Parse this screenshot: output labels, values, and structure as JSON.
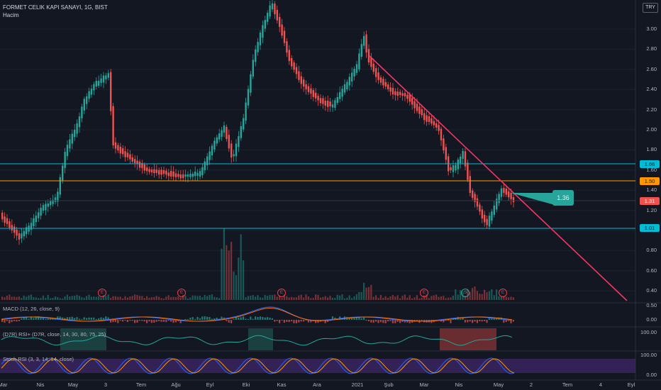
{
  "header": {
    "symbol_line": "FORMET CELIK KAPI SANAYI, 1G, BIST",
    "volume_label": "Hacim",
    "currency_button": "TRY"
  },
  "price_axis": [
    "3.00",
    "2.80",
    "2.60",
    "2.40",
    "2.20",
    "2.00",
    "1.80",
    "1.60",
    "1.40",
    "1.20",
    "1.00",
    "0.80",
    "0.60",
    "0.40"
  ],
  "badges": {
    "level_upper": "1.66",
    "level_middle": "1.50",
    "last_price": "1.31",
    "level_lower": "1.01"
  },
  "callout_value": "1.36",
  "indicators": {
    "macd": {
      "label": "MACD (12, 26, close, 9)",
      "axis": [
        "0.50",
        "0.00"
      ]
    },
    "rsi": {
      "label": "(D7R) RSI+ (D7R, close, 14, 30, 80, 75, 25)",
      "axis": [
        "100.00"
      ]
    },
    "stoch": {
      "label": "Stoch RSI (3, 3, 14, 14, close)",
      "axis": [
        "100.00",
        "0.00"
      ]
    }
  },
  "events": [
    {
      "letter": "E",
      "kind": "earnings"
    },
    {
      "letter": "E",
      "kind": "earnings"
    },
    {
      "letter": "E",
      "kind": "earnings"
    },
    {
      "letter": "E",
      "kind": "earnings"
    },
    {
      "letter": "S",
      "kind": "split"
    },
    {
      "letter": "E",
      "kind": "earnings"
    }
  ],
  "time_axis": [
    "Mar",
    "Nis",
    "May",
    "3",
    "Tem",
    "Ağu",
    "Eyl",
    "Eki",
    "Kas",
    "Ara",
    "2021",
    "Şub",
    "Mar",
    "Nis",
    "May",
    "2",
    "Tem",
    "4",
    "Eyl"
  ],
  "colors": {
    "background": "#131722",
    "up": "#26a69a",
    "down": "#ef5350",
    "horizontal_lines": "#00bcd4",
    "middle_line": "#ff9800",
    "trendline": "#f23665",
    "oscillator_zone": "#4a2a7a"
  }
}
